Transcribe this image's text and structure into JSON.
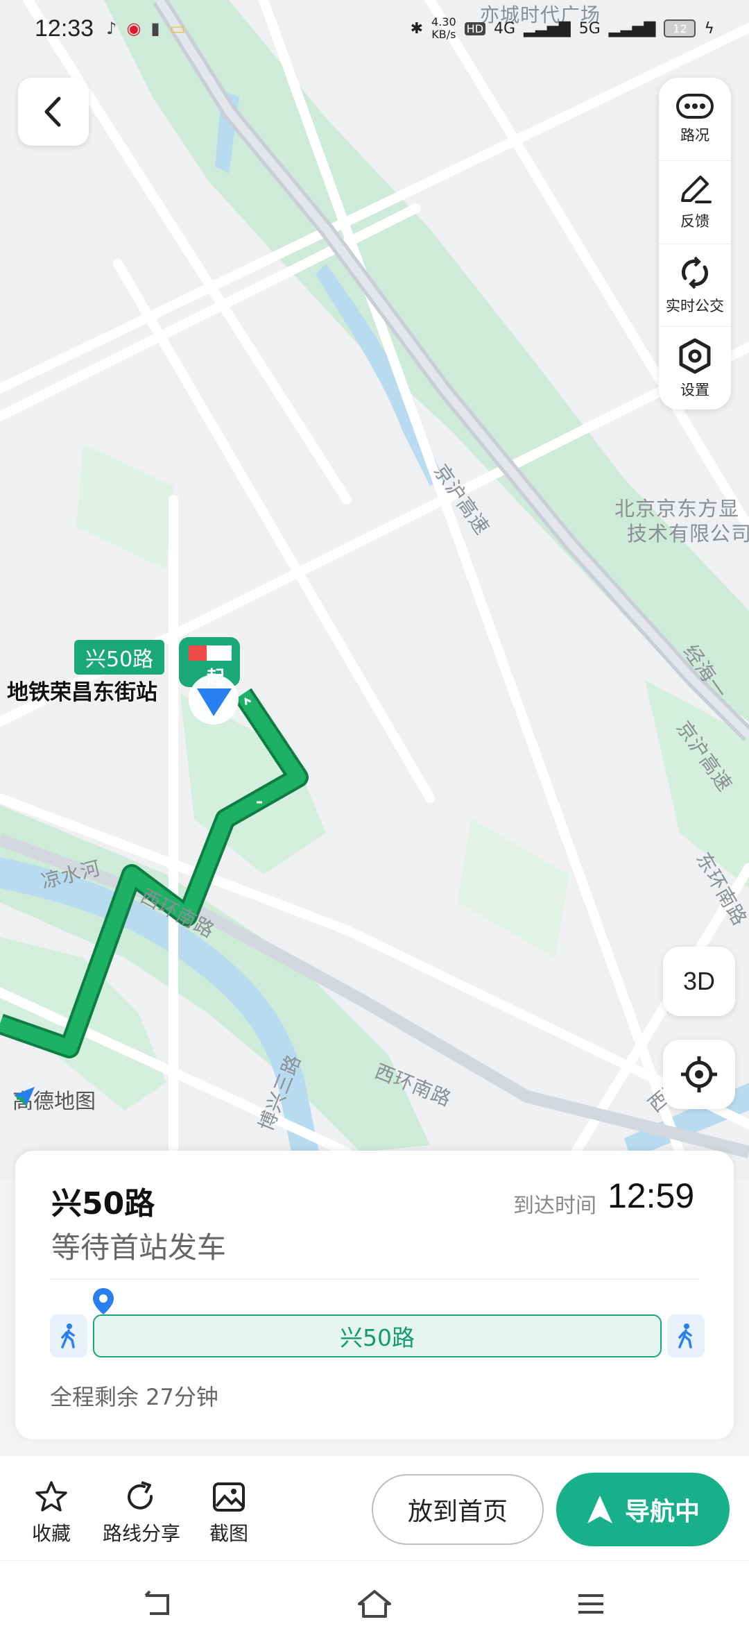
{
  "status_bar": {
    "time": "12:33",
    "net_speed_value": "4.30",
    "net_speed_unit": "KB/s",
    "hd_badge": "HD",
    "net_4g": "4G",
    "net_5g": "5G",
    "battery": "12"
  },
  "map": {
    "labels": {
      "yicheng_plaza": "亦城时代广场",
      "jinghu_expressway": "京沪高速",
      "boe_line1": "北京京东方显",
      "boe_line2": "技术有限公司",
      "jinghai_road": "经海一",
      "jinghu_expressway_2": "京沪高速",
      "dong_ring_south": "东环南路",
      "liangshui_river": "凉水河",
      "xi_ring_south_1": "西环南路",
      "xi_ring_south_2": "西环南路",
      "boxing_3rd": "博兴三路",
      "xi_ring_south_3": "西环"
    },
    "route_tag": "兴50路",
    "station_name": "地铁荣昌东街站",
    "start_marker": "起",
    "brand": "高德地图"
  },
  "tools": [
    {
      "label": "路况",
      "icon": "traffic-icon"
    },
    {
      "label": "反馈",
      "icon": "feedback-pen-icon"
    },
    {
      "label": "实时公交",
      "icon": "realtime-bus-icon"
    },
    {
      "label": "设置",
      "icon": "settings-hex-icon"
    }
  ],
  "buttons": {
    "three_d": "3D"
  },
  "card": {
    "line_title": "兴50路",
    "status": "等待首站发车",
    "arrive_label": "到达时间",
    "arrive_time": "12:59",
    "bus_bar_label": "兴50路",
    "remaining": "全程剩余 27分钟"
  },
  "actions": {
    "favorite": "收藏",
    "share_route": "路线分享",
    "screenshot": "截图",
    "pin_home": "放到首页",
    "navigating": "导航中"
  },
  "colors": {
    "route_green": "#14a05a",
    "accent_teal": "#17b08a",
    "park_green": "#c9ecd6",
    "river_blue": "#b8d9ef"
  }
}
